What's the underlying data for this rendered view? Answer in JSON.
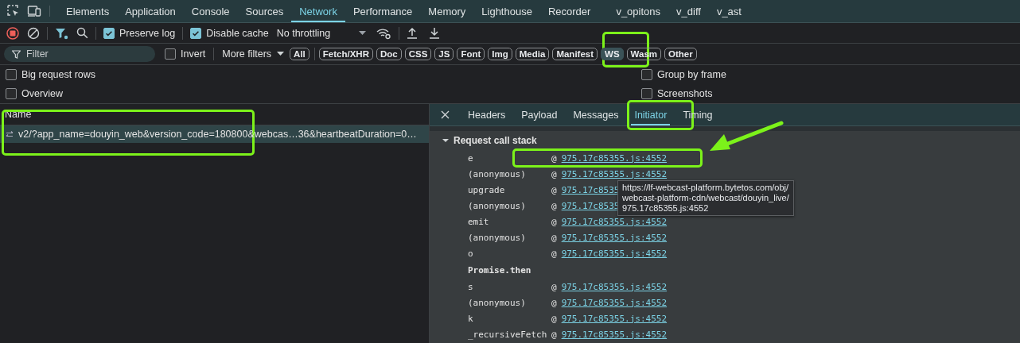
{
  "top_tabs": [
    {
      "label": "Elements",
      "selected": false
    },
    {
      "label": "Application",
      "selected": false
    },
    {
      "label": "Console",
      "selected": false
    },
    {
      "label": "Sources",
      "selected": false
    },
    {
      "label": "Network",
      "selected": true
    },
    {
      "label": "Performance",
      "selected": false
    },
    {
      "label": "Memory",
      "selected": false
    },
    {
      "label": "Lighthouse",
      "selected": false
    },
    {
      "label": "Recorder",
      "selected": false
    },
    {
      "label": "v_opitons",
      "selected": false
    },
    {
      "label": "v_diff",
      "selected": false
    },
    {
      "label": "v_ast",
      "selected": false
    }
  ],
  "toolbar": {
    "recording": true,
    "preserve_log": {
      "label": "Preserve log",
      "checked": true
    },
    "disable_cache": {
      "label": "Disable cache",
      "checked": true
    },
    "throttling": "No throttling"
  },
  "filter_bar": {
    "placeholder": "Filter",
    "invert": {
      "label": "Invert",
      "checked": false
    },
    "more_filters": "More filters",
    "type_filters": [
      {
        "label": "All",
        "selected": false
      },
      {
        "label": "Fetch/XHR",
        "selected": false
      },
      {
        "label": "Doc",
        "selected": false
      },
      {
        "label": "CSS",
        "selected": false
      },
      {
        "label": "JS",
        "selected": false
      },
      {
        "label": "Font",
        "selected": false
      },
      {
        "label": "Img",
        "selected": false
      },
      {
        "label": "Media",
        "selected": false
      },
      {
        "label": "Manifest",
        "selected": false
      },
      {
        "label": "WS",
        "selected": true
      },
      {
        "label": "Wasm",
        "selected": false
      },
      {
        "label": "Other",
        "selected": false
      }
    ]
  },
  "options": [
    {
      "label": "Big request rows",
      "checked": false
    },
    {
      "label": "Group by frame",
      "checked": false
    },
    {
      "label": "Overview",
      "checked": false
    },
    {
      "label": "Screenshots",
      "checked": false
    }
  ],
  "requests": {
    "column": "Name",
    "rows": [
      {
        "name": "v2/?app_name=douyin_web&version_code=180800&webcas…36&heartbeatDuration=0…",
        "selected": true
      }
    ]
  },
  "detail": {
    "tabs": [
      {
        "label": "Headers",
        "selected": false
      },
      {
        "label": "Payload",
        "selected": false
      },
      {
        "label": "Messages",
        "selected": false
      },
      {
        "label": "Initiator",
        "selected": true
      },
      {
        "label": "Timing",
        "selected": false
      }
    ],
    "section": {
      "title": "Request call stack",
      "expanded": true,
      "frames": [
        {
          "kind": "frame",
          "function": "e",
          "at": "@",
          "link": "975.17c85355.js:4552"
        },
        {
          "kind": "frame",
          "function": "(anonymous)",
          "at": "@",
          "link": "975.17c85355.js:4552"
        },
        {
          "kind": "frame",
          "function": "upgrade",
          "at": "@",
          "link": "975.17c8535"
        },
        {
          "kind": "frame",
          "function": "(anonymous)",
          "at": "@",
          "link": "975.17c8535"
        },
        {
          "kind": "frame",
          "function": "emit",
          "at": "@",
          "link": "975.17c85355.js:4552"
        },
        {
          "kind": "frame",
          "function": "(anonymous)",
          "at": "@",
          "link": "975.17c85355.js:4552"
        },
        {
          "kind": "frame",
          "function": "o",
          "at": "@",
          "link": "975.17c85355.js:4552"
        },
        {
          "kind": "async",
          "function": "Promise.then"
        },
        {
          "kind": "frame",
          "function": "s",
          "at": "@",
          "link": "975.17c85355.js:4552"
        },
        {
          "kind": "frame",
          "function": "(anonymous)",
          "at": "@",
          "link": "975.17c85355.js:4552"
        },
        {
          "kind": "frame",
          "function": "k",
          "at": "@",
          "link": "975.17c85355.js:4552"
        },
        {
          "kind": "frame",
          "function": "_recursiveFetch",
          "at": "@",
          "link": "975.17c85355.js:4552"
        }
      ]
    },
    "tooltip": {
      "lines": [
        "https://lf-webcast-platform.bytetos.com/obj/",
        "webcast-platform-cdn/webcast/douyin_live/",
        "975.17c85355.js:4552"
      ]
    }
  }
}
